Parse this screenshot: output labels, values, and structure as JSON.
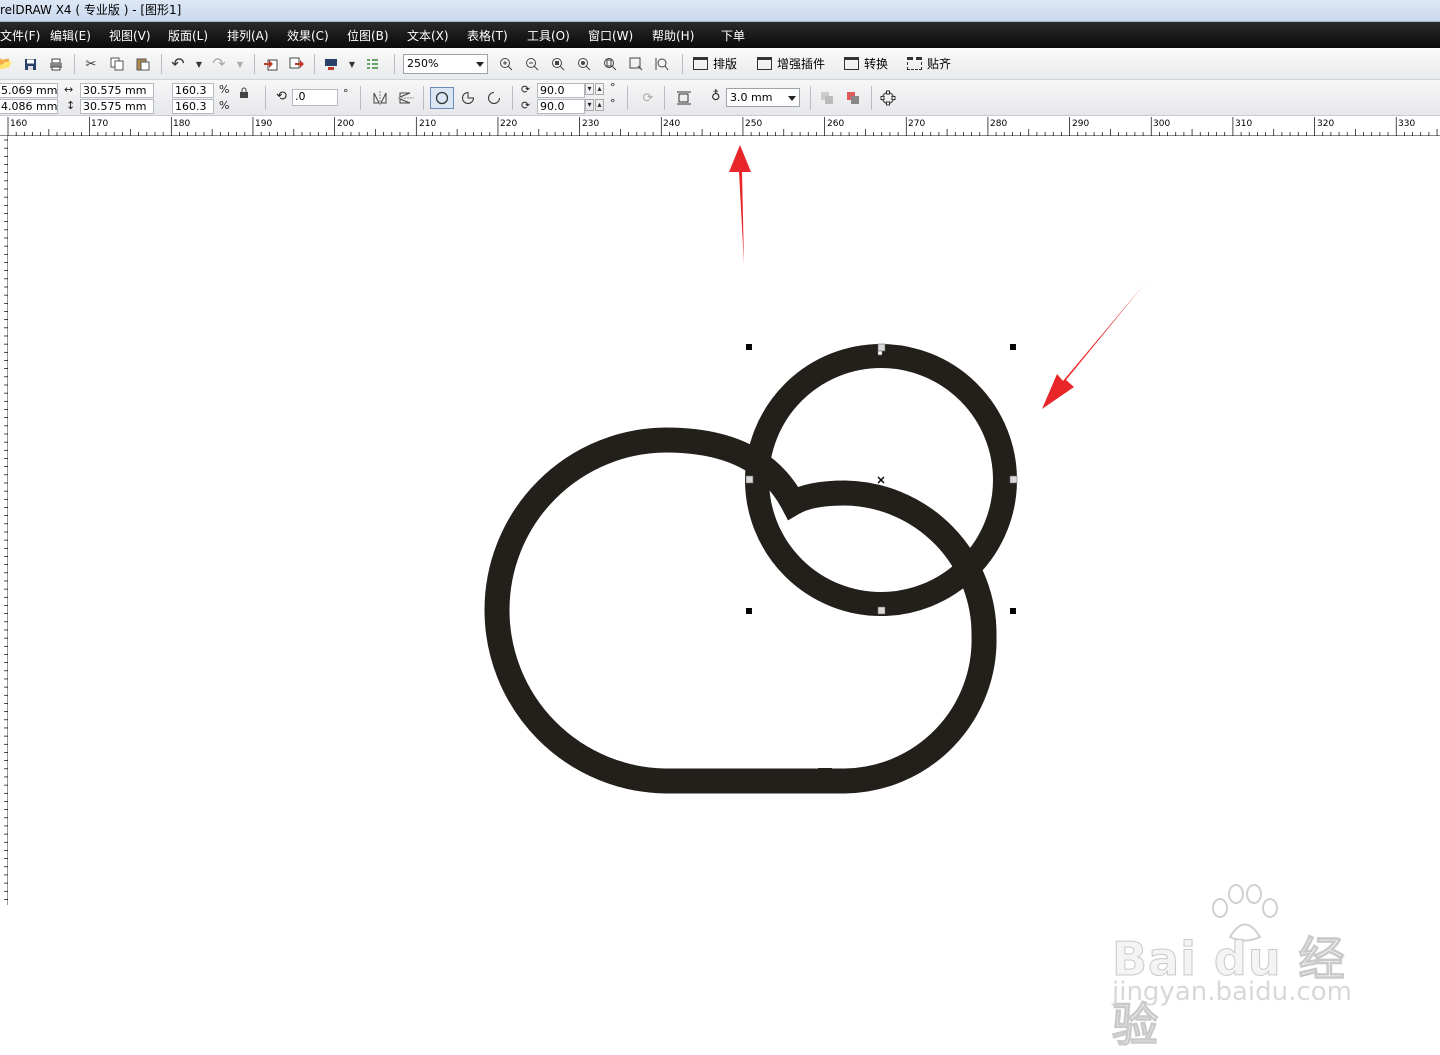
{
  "window": {
    "title": "relDRAW X4 ( 专业版 ) - [图形1]"
  },
  "menu": [
    "文件(F)",
    "编辑(E)",
    "视图(V)",
    "版面(L)",
    "排列(A)",
    "效果(C)",
    "位图(B)",
    "文本(X)",
    "表格(T)",
    "工具(O)",
    "窗口(W)",
    "帮助(H)",
    "下单"
  ],
  "toolbar": {
    "zoom_value": "250%",
    "plugins": [
      "排版",
      "增强插件",
      "转换",
      "贴齐"
    ]
  },
  "property_bar": {
    "x": "5.069 mm",
    "y": "4.086 mm",
    "width": "30.575 mm",
    "height": "30.575 mm",
    "scale_w": "160.3",
    "scale_h": "160.3",
    "percent": "%",
    "rotation": ".0",
    "degree": "°",
    "start_angle": "90.0",
    "end_angle": "90.0",
    "outline_width": "3.0 mm"
  },
  "ruler": {
    "labels": [
      "160",
      "170",
      "180",
      "190",
      "200",
      "210",
      "220",
      "230",
      "240",
      "250",
      "260",
      "270",
      "280",
      "290",
      "300",
      "310",
      "320",
      "330"
    ]
  },
  "watermark": {
    "main": "Bai du 经验",
    "sub": "jingyan.baidu.com"
  },
  "colors": {
    "shape_stroke": "#23201c",
    "arrow": "#e8262a",
    "menubar": "#111111"
  }
}
